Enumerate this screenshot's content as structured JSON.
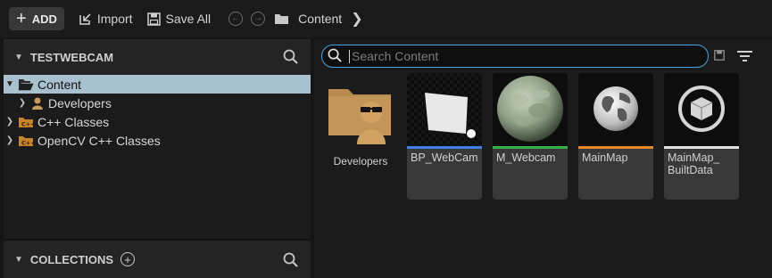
{
  "toolbar": {
    "add_label": "ADD",
    "import_label": "Import",
    "save_all_label": "Save All",
    "breadcrumb": "Content"
  },
  "sources": {
    "header": "TESTWEBCAM",
    "tree": [
      {
        "label": "Content",
        "selected": true,
        "icon": "open-folder-icon"
      },
      {
        "label": "Developers",
        "icon": "developer-folder-icon"
      },
      {
        "label": "C++ Classes",
        "icon": "cpp-folder-icon"
      },
      {
        "label": "OpenCV C++ Classes",
        "icon": "cpp-folder-icon"
      }
    ]
  },
  "collections": {
    "header": "COLLECTIONS"
  },
  "search": {
    "placeholder": "Search Content"
  },
  "assets": [
    {
      "label": "Developers",
      "type": "folder",
      "icon": "developer-folder-icon"
    },
    {
      "label": "BP_WebCam",
      "type": "blueprint",
      "stripe_color": "#3f7fe0"
    },
    {
      "label": "M_Webcam",
      "type": "material",
      "stripe_color": "#35b04a"
    },
    {
      "label": "MainMap",
      "type": "level",
      "stripe_color": "#e08b28"
    },
    {
      "label": "MainMap_ BuiltData",
      "type": "map_build_data",
      "stripe_color": "#e0e0e0"
    }
  ],
  "colors": {
    "accent_blue": "#4aa3e0",
    "selection": "#a9c1cf"
  }
}
